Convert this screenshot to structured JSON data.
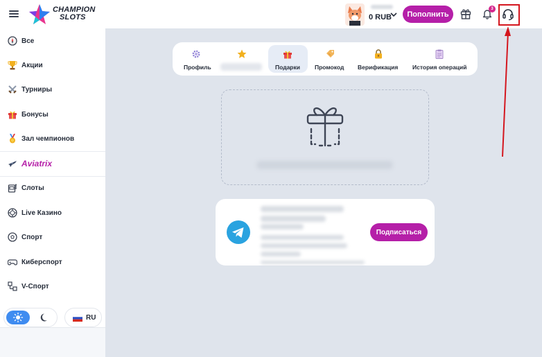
{
  "header": {
    "brand_line1": "CHAMPION",
    "brand_line2": "SLOTS",
    "balance": "0 RUB",
    "deposit_label": "Пополнить",
    "notifications_count": "3"
  },
  "sidebar": {
    "items": [
      {
        "label": "Все",
        "icon": "compass-icon"
      },
      {
        "label": "Акции",
        "icon": "trophy-icon"
      },
      {
        "label": "Турниры",
        "icon": "crossed-swords-icon"
      },
      {
        "label": "Бонусы",
        "icon": "gift-icon"
      },
      {
        "label": "Зал чемпионов",
        "icon": "medal-icon"
      },
      {
        "label": "Aviatrix",
        "icon": "airplane-icon"
      },
      {
        "label": "Слоты",
        "icon": "slot-machine-icon"
      },
      {
        "label": "Live Казино",
        "icon": "casino-chip-icon"
      },
      {
        "label": "Спорт",
        "icon": "soccer-ball-icon"
      },
      {
        "label": "Киберспорт",
        "icon": "gamepad-icon"
      },
      {
        "label": "V-Спорт",
        "icon": "v-sport-icon"
      }
    ],
    "language": "RU"
  },
  "tabs": [
    {
      "label": "Профиль",
      "icon": "gear-icon"
    },
    {
      "label": "",
      "icon": "star-icon"
    },
    {
      "label": "Подарки",
      "icon": "gift-icon",
      "active": true
    },
    {
      "label": "Промокод",
      "icon": "ticket-icon"
    },
    {
      "label": "Верификация",
      "icon": "lock-icon"
    },
    {
      "label": "История операций",
      "icon": "clipboard-icon"
    }
  ],
  "telegram": {
    "subscribe_label": "Подписаться"
  },
  "colors": {
    "accent": "#b51fa8",
    "annotation": "#d4161e",
    "background": "#dfe4ec"
  }
}
